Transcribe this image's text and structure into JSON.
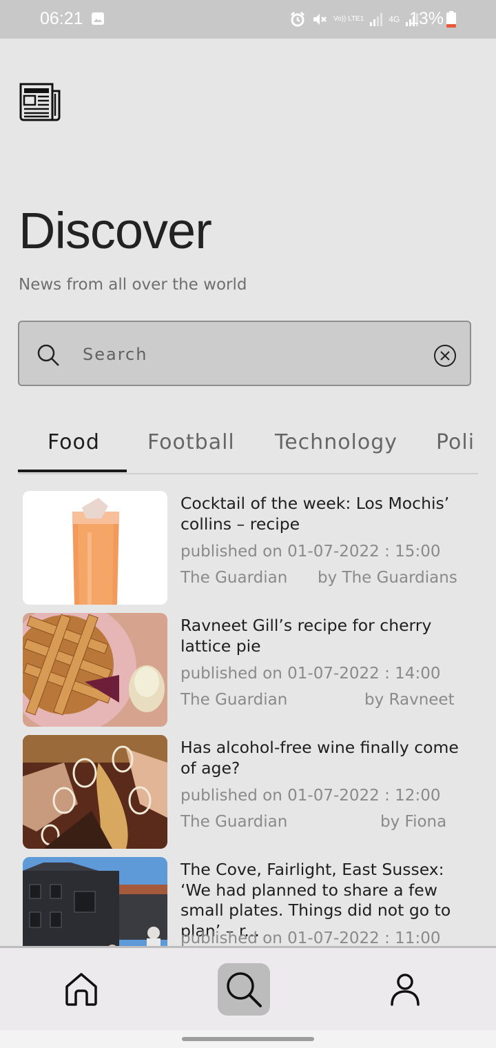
{
  "status_bar": {
    "time": "06:21",
    "battery_text": "13%",
    "icons": [
      "gallery-icon",
      "alarm-icon",
      "mute-icon",
      "volte-icon",
      "signal-icon",
      "4g-icon",
      "signal-icon-2",
      "battery-icon"
    ],
    "volte_label": "Vo)) LTE1",
    "network_label": "4G"
  },
  "header": {
    "logo_icon": "newspaper-icon",
    "title": "Discover",
    "subtitle": "News from all over the world"
  },
  "search": {
    "placeholder": "Search",
    "value": ""
  },
  "tabs": [
    {
      "label": "Food",
      "active": true
    },
    {
      "label": "Football",
      "active": false
    },
    {
      "label": "Technology",
      "active": false
    },
    {
      "label": "Poli",
      "active": false
    }
  ],
  "articles": [
    {
      "title": "Cocktail of the week: Los Mochis’ collins – recipe",
      "published": "published on 01-07-2022 : 15:00",
      "source": "The Guardian",
      "author": "by The Guardians",
      "thumb": "cocktail-image"
    },
    {
      "title": "Ravneet Gill’s recipe for cherry lattice pie",
      "published": "published on 01-07-2022 : 14:00",
      "source": "The Guardian",
      "author": "by Ravneet",
      "thumb": "cherry-pie-image"
    },
    {
      "title": "Has alcohol-free wine finally come of age?",
      "published": "published on 01-07-2022 : 12:00",
      "source": "The Guardian",
      "author": "by Fiona",
      "thumb": "wine-glasses-image"
    },
    {
      "title": "The Cove, Fairlight, East Sussex: ‘We had planned to share a few small plates. Things did not go to plan’ – r...",
      "published": "published on 01-07-2022 : 11:00",
      "source": "",
      "author": "",
      "thumb": "restaurant-image"
    }
  ],
  "bottom_nav": [
    {
      "icon": "home-icon",
      "active": false
    },
    {
      "icon": "search-icon",
      "active": true
    },
    {
      "icon": "profile-icon",
      "active": false
    }
  ],
  "colors": {
    "background": "#e7e6e7",
    "status_bar": "#c8c8c8",
    "search_box": "#cdcccd",
    "active_tab_underline": "#1a1a1a",
    "battery_low": "#e85a3c"
  }
}
